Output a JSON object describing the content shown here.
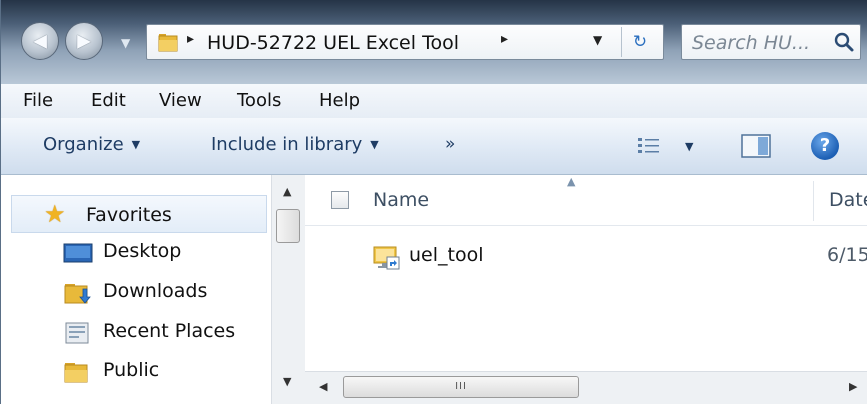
{
  "address_bar": {
    "path_separator": "▸",
    "folder_name": "HUD-52722 UEL Excel Tool",
    "trailing_separator": "▸",
    "dropdown": "▼",
    "refresh_icon": "↻"
  },
  "search": {
    "placeholder": "Search HU..."
  },
  "navigation": {
    "back_arrow": "◀",
    "forward_arrow": "▶",
    "history_dropdown": "▼"
  },
  "menu_bar": {
    "items": [
      "File",
      "Edit",
      "View",
      "Tools",
      "Help"
    ]
  },
  "toolbar": {
    "organize": "Organize",
    "include_in_library": "Include in library",
    "more": "»",
    "dropdown_glyph": "▼"
  },
  "nav_pane": {
    "favorites_label": "Favorites",
    "items": [
      {
        "label": "Desktop",
        "icon": "desktop-icon"
      },
      {
        "label": "Downloads",
        "icon": "downloads-folder-icon"
      },
      {
        "label": "Recent Places",
        "icon": "recent-places-icon"
      },
      {
        "label": "Public",
        "icon": "folder-icon"
      }
    ]
  },
  "file_list": {
    "columns": {
      "name": "Name",
      "date": "Date"
    },
    "items": [
      {
        "name": "uel_tool",
        "date": "6/15",
        "icon": "shortcut-icon"
      }
    ]
  },
  "scrollbars": {
    "up": "▲",
    "down": "▼",
    "left": "◀",
    "right": "▶",
    "grip": "III"
  },
  "colors": {
    "accent": "#1e3c64",
    "selection": "#e3edf8",
    "folder": "#e8b93a"
  }
}
